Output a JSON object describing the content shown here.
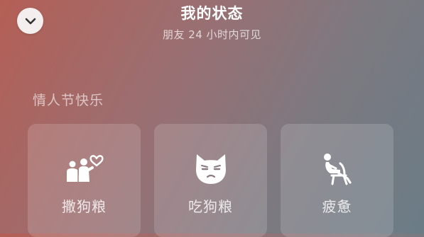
{
  "header": {
    "title": "我的状态",
    "subtitle": "朋友 24 小时内可见",
    "collapse_icon": "chevron-down-icon"
  },
  "section": {
    "label": "情人节快乐"
  },
  "cards": [
    {
      "label": "撒狗粮",
      "icon": "couple-heart-icon"
    },
    {
      "label": "吃狗粮",
      "icon": "cat-face-icon"
    },
    {
      "label": "疲惫",
      "icon": "person-reclining-icon"
    }
  ]
}
